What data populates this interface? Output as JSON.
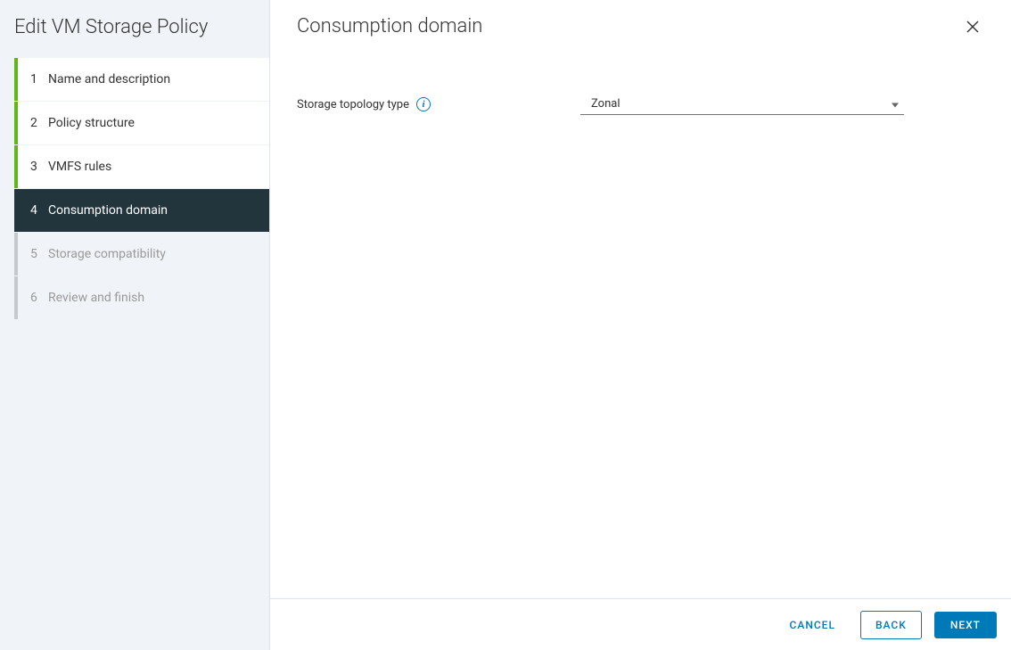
{
  "sidebar": {
    "title": "Edit VM Storage Policy",
    "steps": [
      {
        "num": "1",
        "label": "Name and description",
        "state": "completed"
      },
      {
        "num": "2",
        "label": "Policy structure",
        "state": "completed"
      },
      {
        "num": "3",
        "label": "VMFS rules",
        "state": "completed"
      },
      {
        "num": "4",
        "label": "Consumption domain",
        "state": "active"
      },
      {
        "num": "5",
        "label": "Storage compatibility",
        "state": "pending"
      },
      {
        "num": "6",
        "label": "Review and finish",
        "state": "pending"
      }
    ]
  },
  "main": {
    "title": "Consumption domain",
    "form": {
      "storageTopologyLabel": "Storage topology type",
      "storageTopologyValue": "Zonal"
    }
  },
  "footer": {
    "cancel": "CANCEL",
    "back": "BACK",
    "next": "NEXT"
  }
}
